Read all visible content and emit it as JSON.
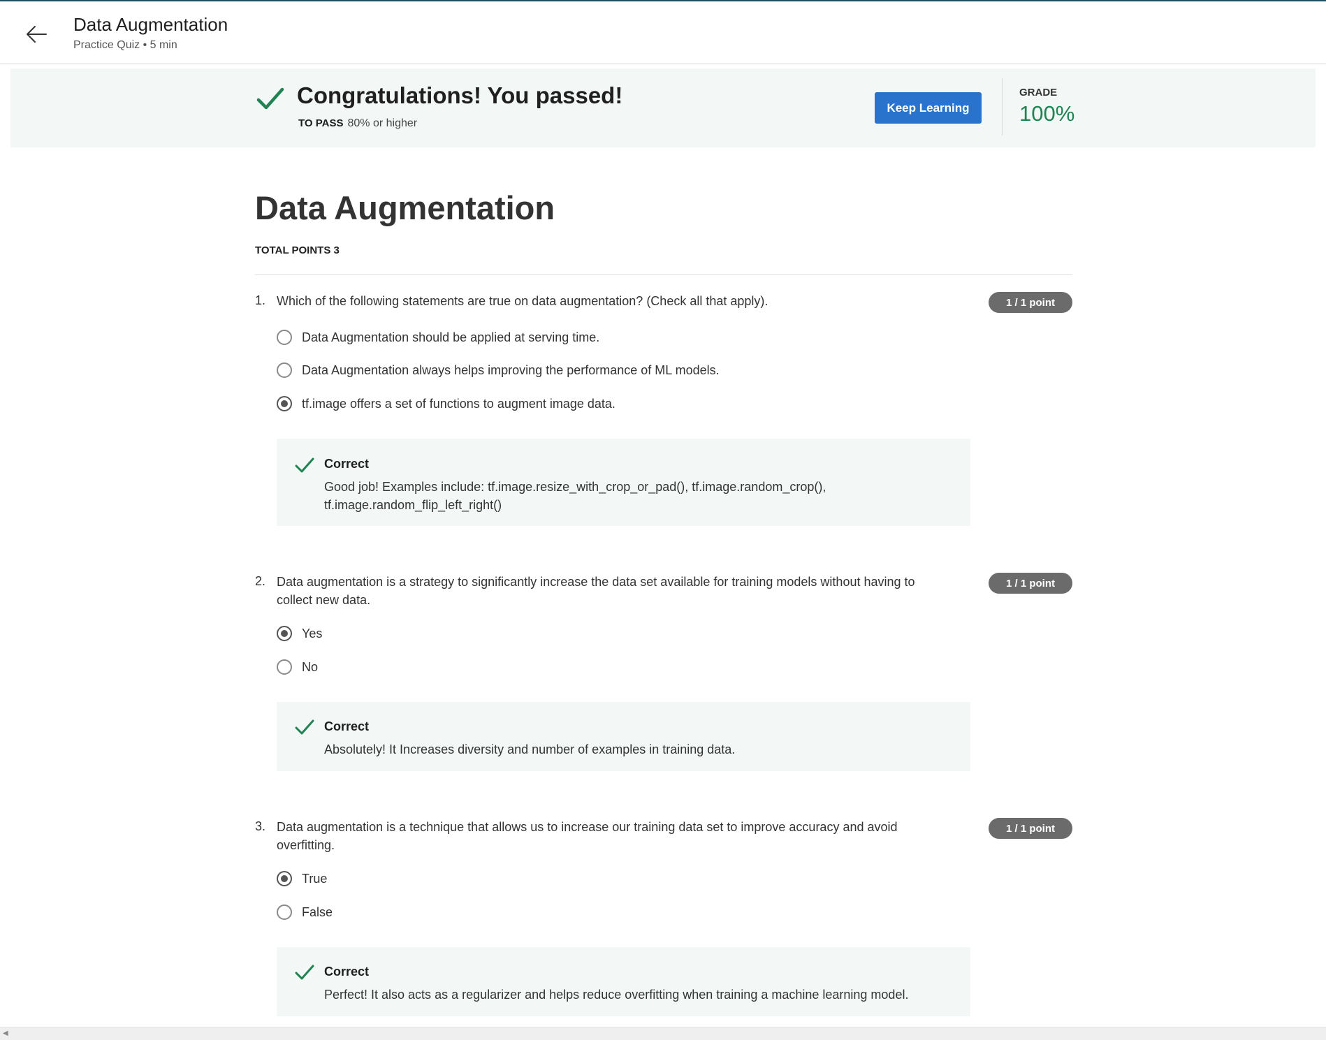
{
  "header": {
    "title": "Data Augmentation",
    "subtitle": "Practice Quiz • 5 min"
  },
  "banner": {
    "message": "Congratulations! You passed!",
    "to_pass_label": "TO PASS",
    "to_pass_value": "80% or higher",
    "keep_learning_label": "Keep Learning",
    "grade_label": "GRADE",
    "grade_value": "100%"
  },
  "quiz": {
    "title": "Data Augmentation",
    "total_points": "TOTAL POINTS 3"
  },
  "questions": [
    {
      "number": "1.",
      "text": "Which of the following statements are true on data augmentation? (Check all that apply).",
      "points": "1 / 1 point",
      "options": [
        {
          "label": "Data Augmentation should be applied at serving time.",
          "selected": false
        },
        {
          "label": "Data Augmentation always helps improving the performance of ML models.",
          "selected": false
        },
        {
          "label": "tf.image offers a set of functions to augment image data.",
          "selected": true
        }
      ],
      "feedback": {
        "title": "Correct",
        "text": "Good job! Examples include: tf.image.resize_with_crop_or_pad(), tf.image.random_crop(), tf.image.random_flip_left_right()"
      }
    },
    {
      "number": "2.",
      "text": "Data augmentation is a strategy to significantly increase the data set available for training models without having to collect new data.",
      "points": "1 / 1 point",
      "options": [
        {
          "label": "Yes",
          "selected": true
        },
        {
          "label": "No",
          "selected": false
        }
      ],
      "feedback": {
        "title": "Correct",
        "text": "Absolutely! It Increases diversity and number of examples in training data."
      }
    },
    {
      "number": "3.",
      "text": "Data augmentation is a technique that allows us to increase our training data set to improve accuracy and avoid overfitting.",
      "points": "1 / 1 point",
      "options": [
        {
          "label": "True",
          "selected": true
        },
        {
          "label": "False",
          "selected": false
        }
      ],
      "feedback": {
        "title": "Correct",
        "text": "Perfect! It also acts as a regularizer and helps reduce overfitting when training a machine learning model."
      }
    }
  ],
  "colors": {
    "accent": "#2a73cc",
    "success": "#1f8354",
    "banner_bg": "#f3f8f6"
  },
  "icons": {
    "back": "arrow-left-icon",
    "check": "check-icon"
  }
}
